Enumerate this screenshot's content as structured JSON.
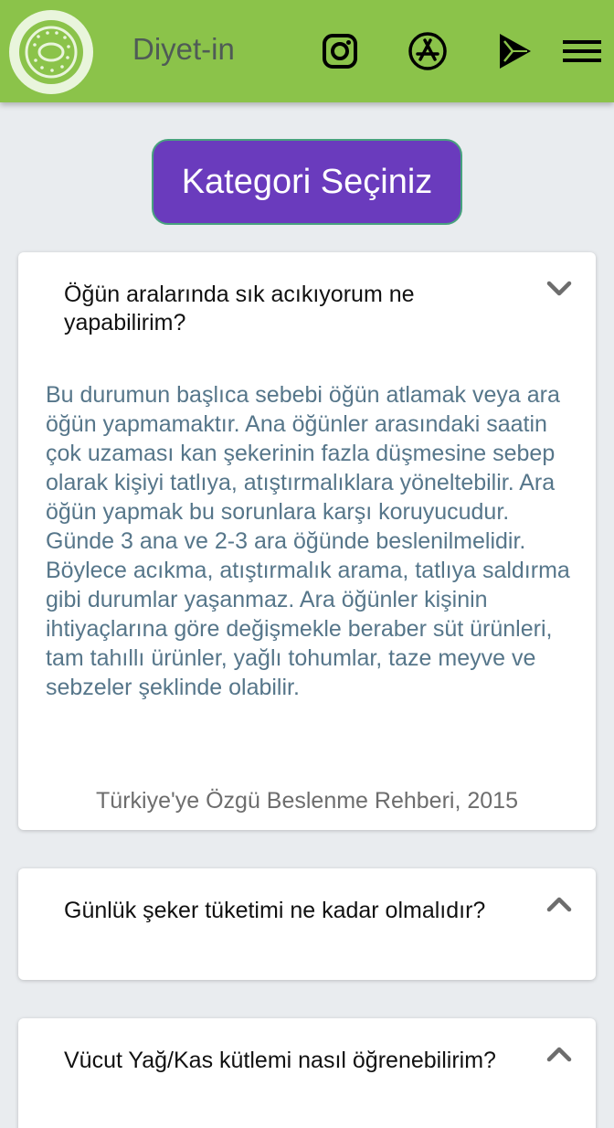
{
  "header": {
    "brand": "Diyet-in",
    "icons": [
      "kiwi-logo-icon",
      "instagram-icon",
      "app-store-icon",
      "google-play-icon",
      "hamburger-menu-icon"
    ],
    "colors": {
      "bar": "#8bc34a",
      "brand_text": "#4f5b56"
    }
  },
  "category_button": {
    "label": "Kategori Seçiniz",
    "color": "#6a3bbd"
  },
  "faq": [
    {
      "question": "Öğün aralarında sık acıkıyorum ne yapabilirim?",
      "expanded": true,
      "answer": "Bu durumun başlıca sebebi öğün atlamak veya ara öğün yapmamaktır. Ana öğünler arasındaki saatin çok uzaması kan şekerinin fazla düşmesine sebep olarak kişiyi tatlıya, atıştırmalıklara yöneltebilir. Ara öğün yapmak bu sorunlara karşı koruyucudur. Günde 3 ana ve 2-3 ara öğünde beslenilmelidir. Böylece acıkma, atıştırmalık arama, tatlıya saldırma gibi durumlar yaşanmaz. Ara öğünler kişinin ihtiyaçlarına göre değişmekle beraber süt ürünleri, tam tahıllı ürünler, yağlı tohumlar, taze meyve ve sebzeler şeklinde olabilir.",
      "source": "Türkiye'ye Özgü Beslenme Rehberi, 2015"
    },
    {
      "question": "Günlük şeker tüketimi ne kadar olmalıdır?",
      "expanded": false
    },
    {
      "question": "Vücut Yağ/Kas kütlemi nasıl öğrenebilirim?",
      "expanded": false
    }
  ]
}
